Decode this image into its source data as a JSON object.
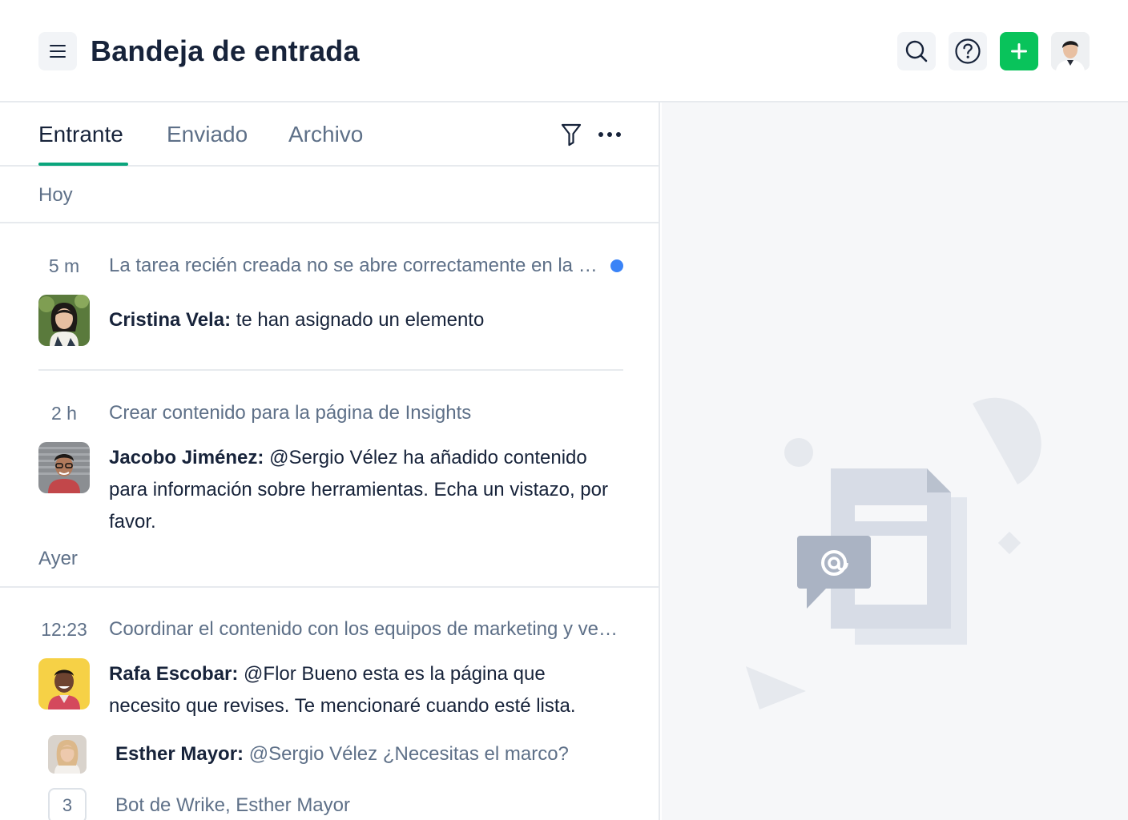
{
  "header": {
    "title": "Bandeja de entrada",
    "menu_icon": "hamburger-icon",
    "search_icon": "search-icon",
    "help_icon": "question-circle-icon",
    "add_icon": "plus-icon",
    "accent_color": "#09c35b"
  },
  "tabs": [
    {
      "label": "Entrante",
      "active": true
    },
    {
      "label": "Enviado",
      "active": false
    },
    {
      "label": "Archivo",
      "active": false
    }
  ],
  "toolbar": {
    "filter_icon": "filter-icon",
    "more_icon": "more-horizontal-icon"
  },
  "sections": {
    "today": "Hoy",
    "yesterday": "Ayer"
  },
  "items": [
    {
      "time": "5 m",
      "subject": "La tarea recién creada no se abre correctamente en la aplicación",
      "unread": true,
      "author": "Cristina Vela:",
      "text": " te han asignado un elemento"
    },
    {
      "time": "2 h",
      "subject": "Crear contenido para la página de Insights",
      "unread": false,
      "author": "Jacobo Jiménez:",
      "text": " @Sergio Vélez ha añadido contenido para información sobre herramientas. Echa un vistazo, por favor."
    },
    {
      "time": "12:23",
      "subject": "Coordinar el contenido con los equipos de marketing y ventas",
      "unread": false,
      "author": "Rafa Escobar:",
      "text": " @Flor Bueno esta es la página que necesito que revises. Te mencionaré cuando esté lista.",
      "reply_author": "Esther Mayor:",
      "reply_text": " @Sergio Vélez ¿Necesitas el marco?",
      "more_count": "3",
      "more_text": "Bot de Wrike, Esther Mayor"
    }
  ],
  "empty_state": {
    "illustration": "mention-document-illustration"
  }
}
